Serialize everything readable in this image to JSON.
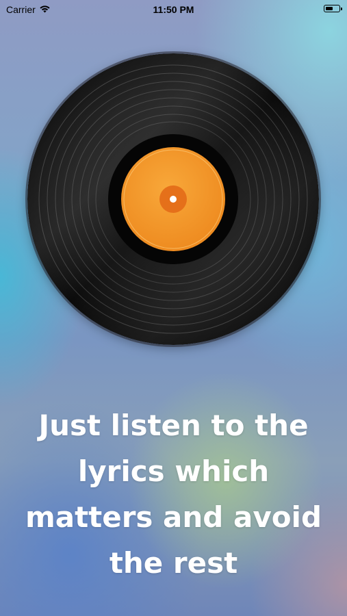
{
  "status_bar": {
    "carrier": "Carrier",
    "time": "11:50 PM",
    "wifi_icon": "wifi-icon",
    "battery_icon": "battery-icon"
  },
  "record": {
    "icon": "vinyl-record-icon",
    "label_color": "#f39a2c",
    "disc_color": "#111111"
  },
  "caption": {
    "text": "Just listen to the lyrics which matters and avoid the rest"
  }
}
